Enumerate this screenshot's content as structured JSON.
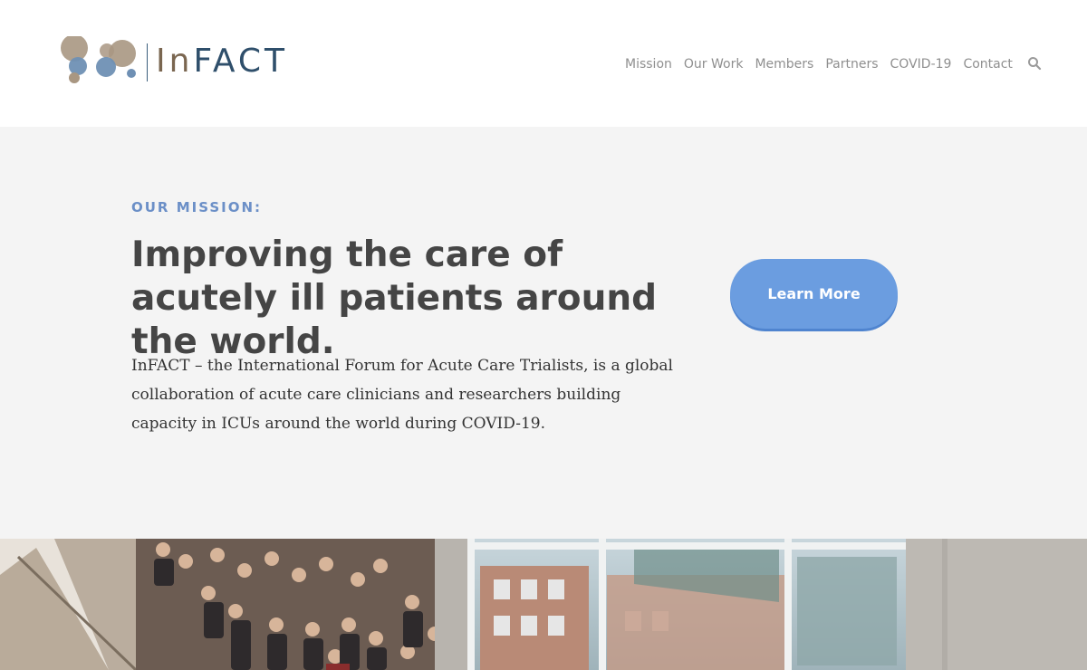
{
  "brand": {
    "name_prefix": "In",
    "name_suffix": "FACT"
  },
  "nav": {
    "items": [
      {
        "label": "Mission"
      },
      {
        "label": "Our Work"
      },
      {
        "label": "Members"
      },
      {
        "label": "Partners"
      },
      {
        "label": "COVID-19"
      },
      {
        "label": "Contact"
      }
    ],
    "search_icon": "search-icon"
  },
  "hero": {
    "eyebrow": "OUR MISSION:",
    "headline": "Improving the care of acutely ill patients around the world.",
    "body": "InFACT – the International Forum for Acute Care Trialists, is a global collaboration of acute care clinicians and researchers building capacity in ICUs around the world during COVID-19.",
    "cta_label": "Learn More"
  },
  "colors": {
    "accent": "#6b9de0",
    "eyebrow": "#6b8fc7",
    "logo_blue": "#2f4f6b",
    "logo_brown": "#7a6650",
    "hero_bg": "#f4f4f4"
  },
  "photo": {
    "subject": "group photo of conference attendees on a staircase"
  }
}
